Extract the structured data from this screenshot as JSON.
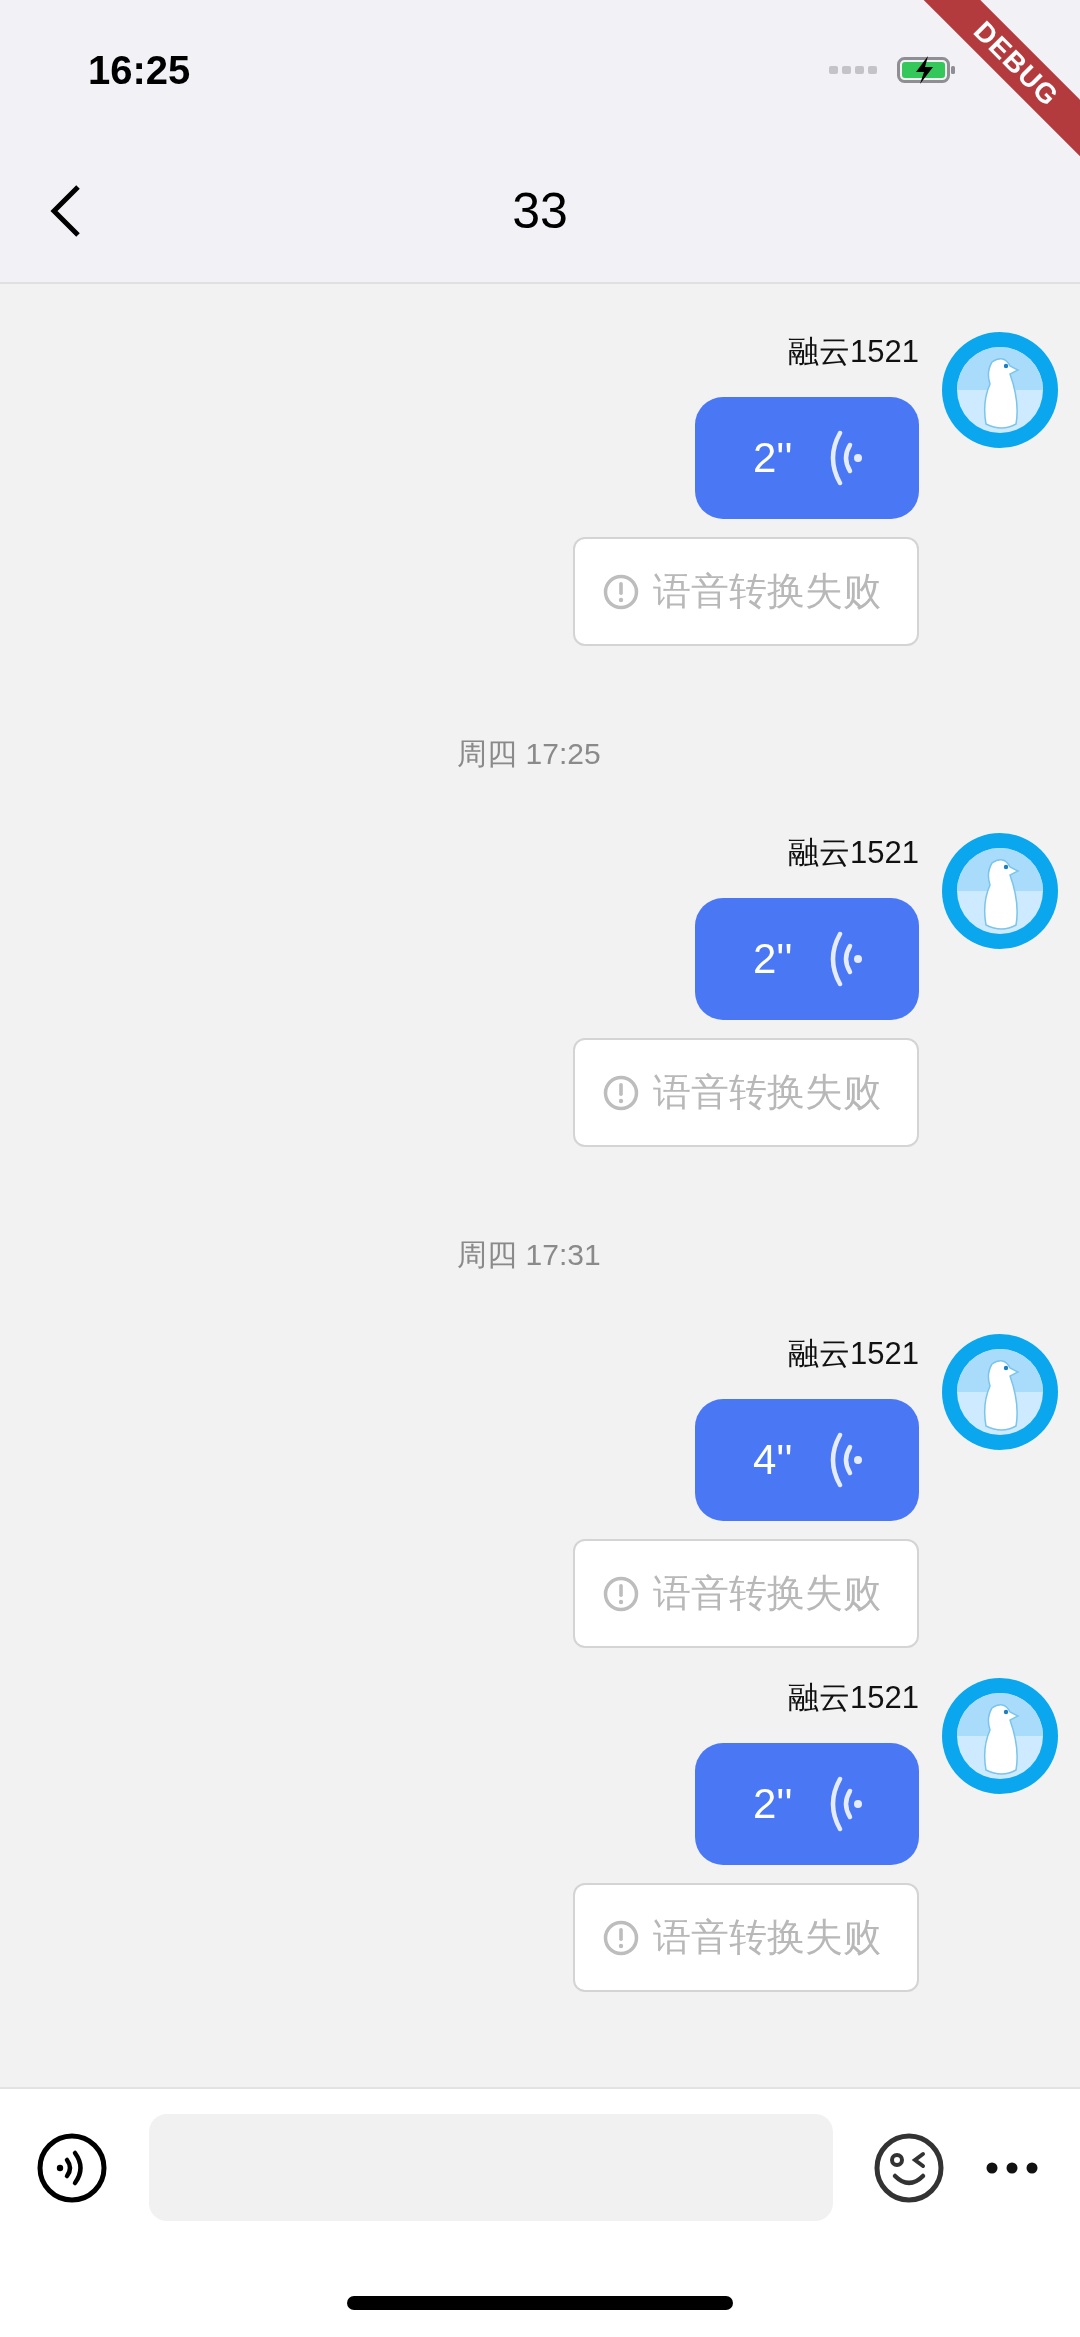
{
  "status_bar": {
    "time": "16:25"
  },
  "debug_banner": {
    "label": "DEBUG"
  },
  "nav": {
    "title": "33"
  },
  "messages": [
    {
      "sender": "融云1521",
      "duration": "2''",
      "transcription": "语音转换失败"
    },
    {
      "timestamp": "周四 17:25",
      "sender": "融云1521",
      "duration": "2''",
      "transcription": "语音转换失败"
    },
    {
      "timestamp": "周四 17:31",
      "sender": "融云1521",
      "duration": "4''",
      "transcription": "语音转换失败"
    },
    {
      "sender": "融云1521",
      "duration": "2''",
      "transcription": "语音转换失败"
    }
  ]
}
